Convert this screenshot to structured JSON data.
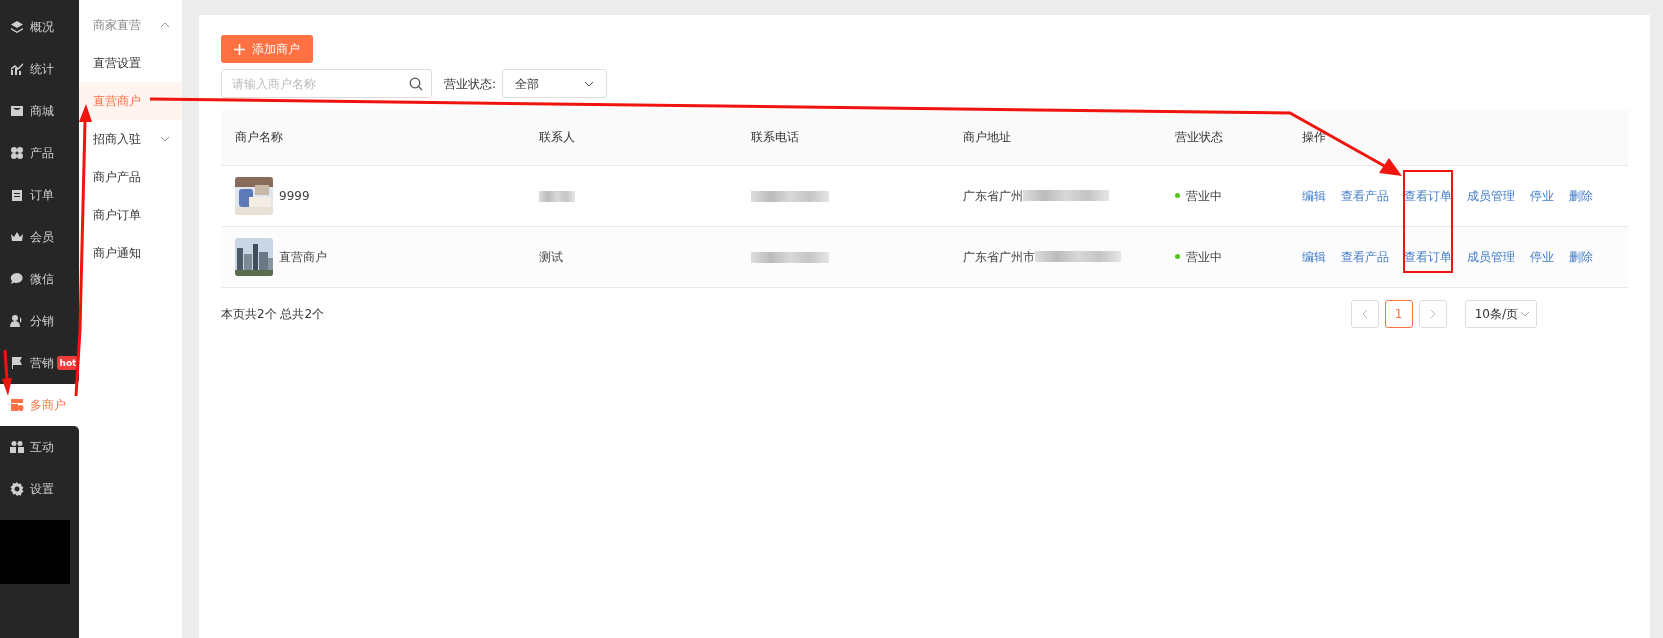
{
  "nav": [
    {
      "label": "概况",
      "selected": false
    },
    {
      "label": "统计",
      "selected": false
    },
    {
      "label": "商城",
      "selected": false
    },
    {
      "label": "产品",
      "selected": false
    },
    {
      "label": "订单",
      "selected": false
    },
    {
      "label": "会员",
      "selected": false
    },
    {
      "label": "微信",
      "selected": false
    },
    {
      "label": "分销",
      "selected": false
    },
    {
      "label": "营销",
      "selected": false,
      "badge": "hot"
    },
    {
      "label": "多商户",
      "selected": true
    },
    {
      "label": "互动",
      "selected": false
    },
    {
      "label": "设置",
      "selected": false
    }
  ],
  "subnav": [
    {
      "kind": "group",
      "label": "商家直营",
      "expanded": true
    },
    {
      "kind": "item",
      "label": "直营设置",
      "selected": false
    },
    {
      "kind": "item",
      "label": "直营商户",
      "selected": true
    },
    {
      "kind": "group",
      "label": "招商入驻",
      "expanded": false
    },
    {
      "kind": "item",
      "label": "商户产品",
      "selected": false
    },
    {
      "kind": "item",
      "label": "商户订单",
      "selected": false
    },
    {
      "kind": "item",
      "label": "商户通知",
      "selected": false
    }
  ],
  "toolbar": {
    "add_button": "添加商户",
    "search": {
      "placeholder": "请输入商户名称"
    },
    "status_filter": {
      "label": "营业状态:",
      "value": "全部"
    }
  },
  "table": {
    "columns": [
      "商户名称",
      "联系人",
      "联系电话",
      "商户地址",
      "营业状态",
      "操作"
    ],
    "rows": [
      {
        "name": "9999",
        "contact": "",
        "address": "广东省广州",
        "status": "营业中",
        "actions": [
          "编辑",
          "查看产品",
          "查看订单",
          "成员管理",
          "停业",
          "删除"
        ]
      },
      {
        "name": "直营商户",
        "contact": "测试",
        "address": "广东省广州市",
        "status": "营业中",
        "actions": [
          "编辑",
          "查看产品",
          "查看订单",
          "成员管理",
          "停业",
          "删除"
        ]
      }
    ]
  },
  "pagination": {
    "summary": "本页共2个 总共2个",
    "pages": [
      {
        "label": "1",
        "selected": true
      }
    ],
    "page_size": "10条/页"
  }
}
